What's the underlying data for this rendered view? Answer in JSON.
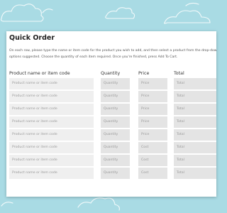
{
  "title": "Quick Order",
  "description": "On each row, please type the name or item code for the product you wish to add, and then select a product from the drop-down options suggested. Choose the quantity of each item required. Once you're finished, press Add To Cart.",
  "headers": {
    "product": "Product name or item code",
    "quantity": "Quantity",
    "price": "Price",
    "total": "Total"
  },
  "rows": [
    {
      "product": "Product name or item code",
      "quantity": "Quantity",
      "price": "Price",
      "total": "Total"
    },
    {
      "product": "Product name or item code",
      "quantity": "Quantity",
      "price": "Price",
      "total": "Total"
    },
    {
      "product": "Product name or item code",
      "quantity": "Quantity",
      "price": "Price",
      "total": "Total"
    },
    {
      "product": "Product name or item code",
      "quantity": "Quantity",
      "price": "Price",
      "total": "Total"
    },
    {
      "product": "Product name or item code",
      "quantity": "Quantity",
      "price": "Price",
      "total": "Total"
    },
    {
      "product": "Product name or item code",
      "quantity": "Quantity",
      "price": "Cost",
      "total": "Total"
    },
    {
      "product": "Product name or item code",
      "quantity": "Quantity",
      "price": "Cost",
      "total": "Total"
    },
    {
      "product": "Product name or item code",
      "quantity": "Quantity",
      "price": "Cost",
      "total": "Total"
    }
  ],
  "colors": {
    "background": "#a9dbe4",
    "card": "#ffffff",
    "input": "#efefef",
    "input_small": "#e4e4e4"
  }
}
